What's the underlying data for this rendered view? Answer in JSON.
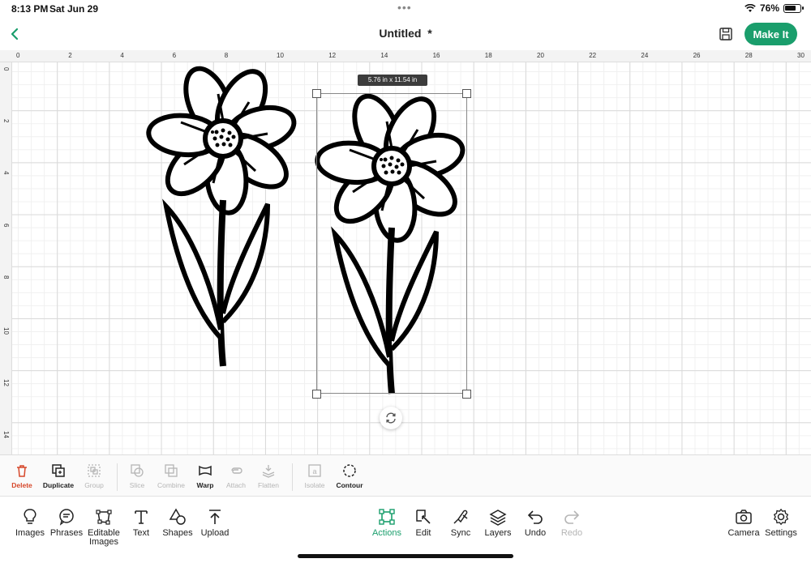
{
  "status": {
    "time": "8:13 PM",
    "date": "Sat Jun 29",
    "battery": "76%",
    "battery_level": 0.76
  },
  "header": {
    "title": "Untitled",
    "modified_mark": "*",
    "make_it_label": "Make It"
  },
  "rulers": {
    "top": [
      "0",
      "2",
      "4",
      "6",
      "8",
      "10",
      "12",
      "14",
      "16",
      "18",
      "20",
      "22",
      "24",
      "26",
      "28",
      "30"
    ],
    "left": [
      "0",
      "2",
      "4",
      "6",
      "8",
      "10",
      "12",
      "14"
    ]
  },
  "selection": {
    "size_label": "5.76 in x 11.54 in"
  },
  "actions": [
    {
      "label": "Delete",
      "icon": "trash-icon",
      "enabled": true
    },
    {
      "label": "Duplicate",
      "icon": "duplicate-icon",
      "enabled": true
    },
    {
      "label": "Group",
      "icon": "group-icon",
      "enabled": false
    },
    {
      "label": "Slice",
      "icon": "slice-icon",
      "enabled": false
    },
    {
      "label": "Combine",
      "icon": "combine-icon",
      "enabled": false
    },
    {
      "label": "Warp",
      "icon": "warp-icon",
      "enabled": true
    },
    {
      "label": "Attach",
      "icon": "attach-icon",
      "enabled": false
    },
    {
      "label": "Flatten",
      "icon": "flatten-icon",
      "enabled": false
    },
    {
      "label": "Isolate",
      "icon": "isolate-icon",
      "enabled": false
    },
    {
      "label": "Contour",
      "icon": "contour-icon",
      "enabled": true
    }
  ],
  "tabs": [
    {
      "label": "Images",
      "icon": "lightbulb-icon"
    },
    {
      "label": "Phrases",
      "icon": "speech-bubble-icon"
    },
    {
      "label": "Editable Images",
      "icon": "editable-images-icon"
    },
    {
      "label": "Text",
      "icon": "text-icon"
    },
    {
      "label": "Shapes",
      "icon": "shapes-icon"
    },
    {
      "label": "Upload",
      "icon": "upload-icon"
    },
    {
      "label": "Actions",
      "icon": "actions-icon",
      "active": true
    },
    {
      "label": "Edit",
      "icon": "edit-icon"
    },
    {
      "label": "Sync",
      "icon": "sync-icon"
    },
    {
      "label": "Layers",
      "icon": "layers-icon"
    },
    {
      "label": "Undo",
      "icon": "undo-icon"
    },
    {
      "label": "Redo",
      "icon": "redo-icon",
      "disabled": true
    },
    {
      "label": "Camera",
      "icon": "camera-icon"
    },
    {
      "label": "Settings",
      "icon": "gear-icon"
    }
  ],
  "colors": {
    "accent": "#1a9e6c",
    "delete": "#d6482b",
    "disabled": "#b5b5b5"
  }
}
